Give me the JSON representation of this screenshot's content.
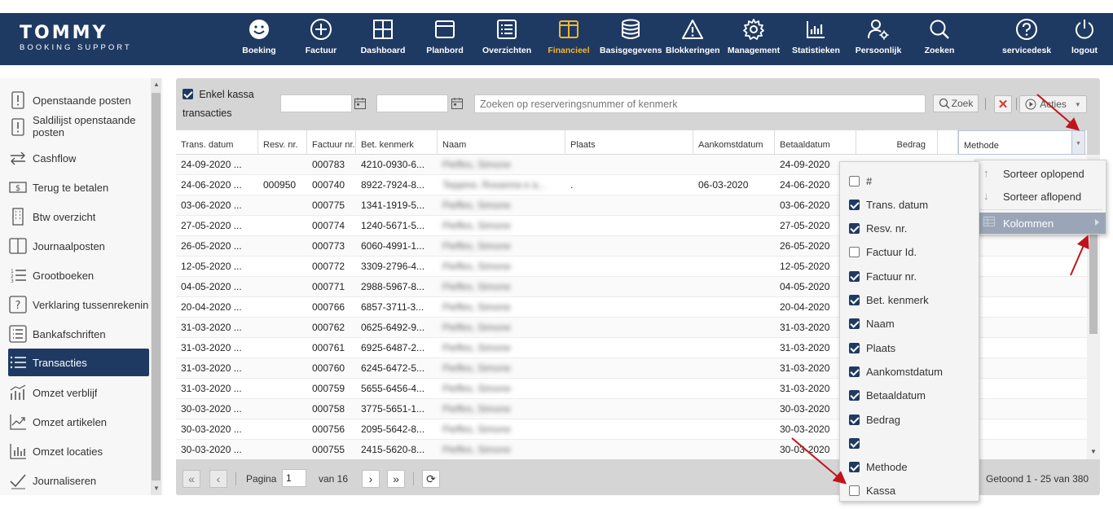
{
  "logo": {
    "title": "TOMMY",
    "subtitle": "BOOKING SUPPORT"
  },
  "nav": [
    {
      "label": "Boeking",
      "icon": "smiley-icon"
    },
    {
      "label": "Factuur",
      "icon": "plus-circle-icon"
    },
    {
      "label": "Dashboard",
      "icon": "grid-icon"
    },
    {
      "label": "Planbord",
      "icon": "window-icon"
    },
    {
      "label": "Overzichten",
      "icon": "list-icon"
    },
    {
      "label": "Financieel",
      "icon": "columns-icon",
      "active": true
    },
    {
      "label": "Basisgegevens",
      "icon": "database-icon"
    },
    {
      "label": "Blokkeringen",
      "icon": "warning-icon"
    },
    {
      "label": "Management",
      "icon": "gear-icon"
    },
    {
      "label": "Statistieken",
      "icon": "bar-chart-icon"
    },
    {
      "label": "Persoonlijk",
      "icon": "user-gear-icon"
    },
    {
      "label": "Zoeken",
      "icon": "search-icon"
    },
    {
      "label": "servicedesk",
      "icon": "help-icon"
    },
    {
      "label": "logout",
      "icon": "power-icon"
    }
  ],
  "sidebar": {
    "items": [
      {
        "label": "Openstaande posten",
        "icon": "exclamation-doc-icon"
      },
      {
        "label": "Saldilijst openstaande posten",
        "icon": "exclamation-doc-icon"
      },
      {
        "label": "Cashflow",
        "icon": "exchange-icon"
      },
      {
        "label": "Terug te betalen",
        "icon": "money-icon"
      },
      {
        "label": "Btw overzicht",
        "icon": "building-icon"
      },
      {
        "label": "Journaalposten",
        "icon": "columns-icon"
      },
      {
        "label": "Grootboeken",
        "icon": "numbered-list-icon"
      },
      {
        "label": "Verklaring tussenrekening",
        "icon": "question-icon"
      },
      {
        "label": "Bankafschriften",
        "icon": "list-icon"
      },
      {
        "label": "Transacties",
        "icon": "bullet-list-icon",
        "active": true
      },
      {
        "label": "Omzet verblijf",
        "icon": "chart-people-icon"
      },
      {
        "label": "Omzet artikelen",
        "icon": "trend-chart-icon"
      },
      {
        "label": "Omzet locaties",
        "icon": "bar-chart-icon"
      },
      {
        "label": "Journaliseren",
        "icon": "check-icon"
      }
    ]
  },
  "toolbar": {
    "enkel_kassa_line1": "Enkel kassa",
    "enkel_kassa_line2": "transacties",
    "date_from": "",
    "date_to": "",
    "search_placeholder": "Zoeken op reserveringsnummer of kenmerk",
    "zoek_label": "Zoek",
    "acties_label": "Acties"
  },
  "grid": {
    "columns": [
      "Trans. datum",
      "Resv. nr.",
      "Factuur nr.",
      "Bet. kenmerk",
      "Naam",
      "Plaats",
      "Aankomstdatum",
      "Betaaldatum",
      "Bedrag",
      "",
      "Methode"
    ],
    "rows": [
      {
        "trans": "24-09-2020 ...",
        "resv": "",
        "factuur": "000783",
        "kenmerk": "4210-0930-6...",
        "naam": "Pieffes, Simone",
        "plaats": "",
        "aankomst": "",
        "betaal": "24-09-2020"
      },
      {
        "trans": "24-06-2020 ...",
        "resv": "000950",
        "factuur": "000740",
        "kenmerk": "8922-7924-8...",
        "naam": "Teppine, Rosanna e a...",
        "plaats": ".",
        "aankomst": "06-03-2020",
        "betaal": "24-06-2020"
      },
      {
        "trans": "03-06-2020 ...",
        "resv": "",
        "factuur": "000775",
        "kenmerk": "1341-1919-5...",
        "naam": "Pieffes, Simone",
        "plaats": "",
        "aankomst": "",
        "betaal": "03-06-2020"
      },
      {
        "trans": "27-05-2020 ...",
        "resv": "",
        "factuur": "000774",
        "kenmerk": "1240-5671-5...",
        "naam": "Pieffes, Simone",
        "plaats": "",
        "aankomst": "",
        "betaal": "27-05-2020"
      },
      {
        "trans": "26-05-2020 ...",
        "resv": "",
        "factuur": "000773",
        "kenmerk": "6060-4991-1...",
        "naam": "Pieffes, Simone",
        "plaats": "",
        "aankomst": "",
        "betaal": "26-05-2020"
      },
      {
        "trans": "12-05-2020 ...",
        "resv": "",
        "factuur": "000772",
        "kenmerk": "3309-2796-4...",
        "naam": "Pieffes, Simone",
        "plaats": "",
        "aankomst": "",
        "betaal": "12-05-2020"
      },
      {
        "trans": "04-05-2020 ...",
        "resv": "",
        "factuur": "000771",
        "kenmerk": "2988-5967-8...",
        "naam": "Pieffes, Simone",
        "plaats": "",
        "aankomst": "",
        "betaal": "04-05-2020"
      },
      {
        "trans": "20-04-2020 ...",
        "resv": "",
        "factuur": "000766",
        "kenmerk": "6857-3711-3...",
        "naam": "Pieffes, Simone",
        "plaats": "",
        "aankomst": "",
        "betaal": "20-04-2020"
      },
      {
        "trans": "31-03-2020 ...",
        "resv": "",
        "factuur": "000762",
        "kenmerk": "0625-6492-9...",
        "naam": "Pieffes, Simone",
        "plaats": "",
        "aankomst": "",
        "betaal": "31-03-2020"
      },
      {
        "trans": "31-03-2020 ...",
        "resv": "",
        "factuur": "000761",
        "kenmerk": "6925-6487-2...",
        "naam": "Pieffes, Simone",
        "plaats": "",
        "aankomst": "",
        "betaal": "31-03-2020"
      },
      {
        "trans": "31-03-2020 ...",
        "resv": "",
        "factuur": "000760",
        "kenmerk": "6245-6472-5...",
        "naam": "Pieffes, Simone",
        "plaats": "",
        "aankomst": "",
        "betaal": "31-03-2020"
      },
      {
        "trans": "31-03-2020 ...",
        "resv": "",
        "factuur": "000759",
        "kenmerk": "5655-6456-4...",
        "naam": "Pieffes, Simone",
        "plaats": "",
        "aankomst": "",
        "betaal": "31-03-2020"
      },
      {
        "trans": "30-03-2020 ...",
        "resv": "",
        "factuur": "000758",
        "kenmerk": "3775-5651-1...",
        "naam": "Pieffes, Simone",
        "plaats": "",
        "aankomst": "",
        "betaal": "30-03-2020"
      },
      {
        "trans": "30-03-2020 ...",
        "resv": "",
        "factuur": "000756",
        "kenmerk": "2095-5642-8...",
        "naam": "Pieffes, Simone",
        "plaats": "",
        "aankomst": "",
        "betaal": "30-03-2020"
      },
      {
        "trans": "30-03-2020 ...",
        "resv": "",
        "factuur": "000755",
        "kenmerk": "2415-5620-8...",
        "naam": "Pieffes, Simone",
        "plaats": "",
        "aankomst": "",
        "betaal": "30-03-2020"
      }
    ]
  },
  "pager": {
    "page_label": "Pagina",
    "page_value": "1",
    "of_label": "van 16",
    "shown": "Getoond 1 - 25 van 380"
  },
  "context_menu": {
    "sort_asc": "Sorteer oplopend",
    "sort_desc": "Sorteer aflopend",
    "columns": "Kolommen"
  },
  "column_menu": [
    {
      "label": "#",
      "checked": false
    },
    {
      "label": "Trans. datum",
      "checked": true
    },
    {
      "label": "Resv. nr.",
      "checked": true
    },
    {
      "label": "Factuur Id.",
      "checked": false
    },
    {
      "label": "Factuur nr.",
      "checked": true
    },
    {
      "label": "Bet. kenmerk",
      "checked": true
    },
    {
      "label": "Naam",
      "checked": true
    },
    {
      "label": "Plaats",
      "checked": true
    },
    {
      "label": "Aankomstdatum",
      "checked": true
    },
    {
      "label": "Betaaldatum",
      "checked": true
    },
    {
      "label": "Bedrag",
      "checked": true
    },
    {
      "label": "",
      "checked": true
    },
    {
      "label": "Methode",
      "checked": true
    },
    {
      "label": "Kassa",
      "checked": false
    }
  ],
  "colors": {
    "navy": "#1f3a62",
    "accent": "#f3b52f",
    "arrow": "#c0141c"
  }
}
